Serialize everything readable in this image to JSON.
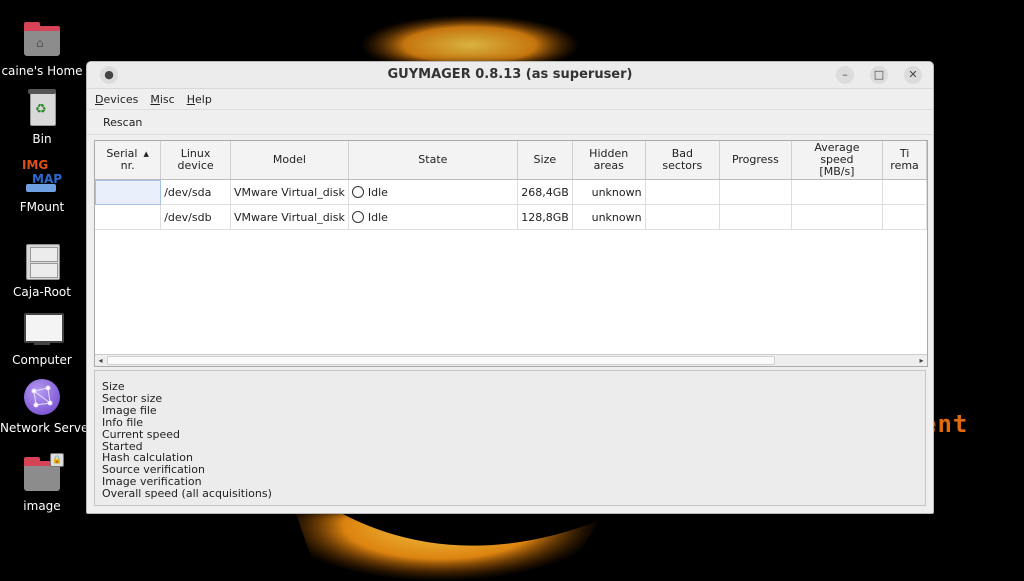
{
  "desktop": {
    "background_text": "ent",
    "icons": [
      {
        "label": "caine's Home",
        "icon": "home-folder-icon"
      },
      {
        "label": "Bin",
        "icon": "trash-bin-icon"
      },
      {
        "label": "FMount",
        "icon": "fmount-icon",
        "overlay_a": "IMG",
        "overlay_b": "MAP"
      },
      {
        "label": "Caja-Root",
        "icon": "file-cabinet-icon"
      },
      {
        "label": "Computer",
        "icon": "computer-icon"
      },
      {
        "label": "Network Servers",
        "icon": "network-globe-icon"
      },
      {
        "label": "image",
        "icon": "locked-folder-icon"
      }
    ]
  },
  "window": {
    "title": "GUYMAGER 0.8.13 (as superuser)",
    "menu": [
      {
        "accel": "D",
        "rest": "evices"
      },
      {
        "accel": "M",
        "rest": "isc"
      },
      {
        "accel": "H",
        "rest": "elp"
      }
    ],
    "toolbar": {
      "rescan_label": "Rescan"
    },
    "table": {
      "headers": [
        {
          "l1": "Serial",
          "l2": "nr."
        },
        {
          "l1": "Linux",
          "l2": "device"
        },
        {
          "l1": "Model",
          "l2": ""
        },
        {
          "l1": "State",
          "l2": ""
        },
        {
          "l1": "Size",
          "l2": ""
        },
        {
          "l1": "Hidden",
          "l2": "areas"
        },
        {
          "l1": "Bad",
          "l2": "sectors"
        },
        {
          "l1": "Progress",
          "l2": ""
        },
        {
          "l1": "Average",
          "l2": "speed",
          "l3": "[MB/s]"
        },
        {
          "l1": "Ti",
          "l2": "rema"
        }
      ],
      "rows": [
        {
          "serial": "",
          "device": "/dev/sda",
          "model": "VMware Virtual_disk",
          "state": "Idle",
          "size": "268,4GB",
          "hidden": "unknown",
          "bad": "",
          "progress": "",
          "speed": "",
          "time": ""
        },
        {
          "serial": "",
          "device": "/dev/sdb",
          "model": "VMware Virtual_disk",
          "state": "Idle",
          "size": "128,8GB",
          "hidden": "unknown",
          "bad": "",
          "progress": "",
          "speed": "",
          "time": ""
        }
      ]
    },
    "info_fields": [
      "Size",
      "Sector size",
      "Image file",
      "Info file",
      "Current speed",
      "Started",
      "Hash calculation",
      "Source verification",
      "Image verification",
      "Overall speed (all acquisitions)"
    ]
  }
}
